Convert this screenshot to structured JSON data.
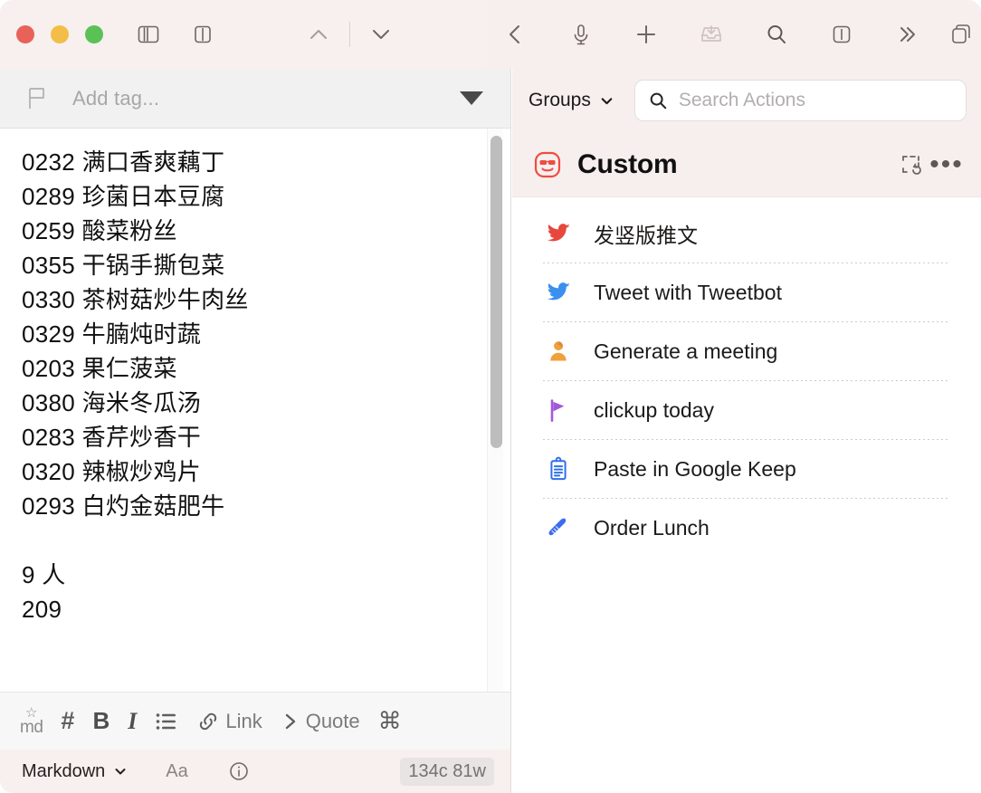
{
  "window": {
    "traffic_lights": [
      {
        "name": "close",
        "color": "#E8625A"
      },
      {
        "name": "minimize",
        "color": "#F2BE48"
      },
      {
        "name": "zoom",
        "color": "#5AC255"
      }
    ]
  },
  "toolbar": {
    "icons": [
      {
        "name": "sidebar-toggle-icon",
        "label": "Toggle Sidebar"
      },
      {
        "name": "editor-toggle-icon",
        "label": "Toggle Editor"
      },
      {
        "name": "chevron-up-icon",
        "label": "Previous"
      },
      {
        "name": "chevron-down-icon",
        "label": "Next"
      },
      {
        "name": "back-chevron-icon",
        "label": "Back"
      },
      {
        "name": "microphone-icon",
        "label": "Dictate"
      },
      {
        "name": "plus-icon",
        "label": "New Note"
      },
      {
        "name": "inbox-icon",
        "label": "Inbox"
      },
      {
        "name": "search-icon",
        "label": "Search"
      },
      {
        "name": "panel-toggle-icon",
        "label": "Toggle Panel"
      },
      {
        "name": "chevrons-right-icon",
        "label": "More"
      },
      {
        "name": "copy-icon",
        "label": "Duplicate"
      }
    ]
  },
  "editor": {
    "tag_bar": {
      "flag_icon": "flag-icon",
      "placeholder": "Add tag...",
      "caret_icon": "caret-down-icon"
    },
    "content": "0232 满口香爽藕丁\n0289 珍菌日本豆腐\n0259 酸菜粉丝\n0355 干锅手撕包菜\n0330 茶树菇炒牛肉丝\n0329 牛腩炖时蔬\n0203 果仁菠菜\n0380 海米冬瓜汤\n0283 香芹炒香干\n0320 辣椒炒鸡片\n0293 白灼金菇肥牛\n\n9 人\n209",
    "lines": [
      "0232 满口香爽藕丁",
      "0289 珍菌日本豆腐",
      "0259 酸菜粉丝",
      "0355 干锅手撕包菜",
      "0330 茶树菇炒牛肉丝",
      "0329 牛腩炖时蔬",
      "0203 果仁菠菜",
      "0380 海米冬瓜汤",
      "0283 香芹炒香干",
      "0320 辣椒炒鸡片",
      "0293 白灼金菇肥牛",
      "",
      "9 人",
      "209"
    ]
  },
  "format_bar": {
    "md_star": "☆",
    "md_text": "md",
    "heading": "#",
    "bold": "B",
    "italic": "I",
    "list_icon": "bullet-list-icon",
    "link_label": "Link",
    "quote_label": "Quote",
    "command": "⌘"
  },
  "status_bar": {
    "mode": "Markdown",
    "mode_caret": "chevron-down-icon",
    "font_size_label": "Aa",
    "info_icon": "info-icon",
    "counts": "134c 81w"
  },
  "actions_panel": {
    "groups_label": "Groups",
    "groups_caret": "chevron-down-icon",
    "search": {
      "icon": "search-icon",
      "placeholder": "Search Actions",
      "value": ""
    },
    "group": {
      "icon": "sunglasses-face-icon",
      "icon_color": "#EE4D42",
      "title": "Custom",
      "refresh_icon": "reload-frame-icon",
      "more_icon": "ellipsis-icon"
    },
    "items": [
      {
        "icon": "twitter-bird-icon",
        "color": "#E8473C",
        "label": "发竖版推文"
      },
      {
        "icon": "twitter-bird-icon",
        "color": "#3B8FEF",
        "label": "Tweet with Tweetbot"
      },
      {
        "icon": "person-silhouette-icon",
        "color": "#F0A03C",
        "label": "Generate a meeting"
      },
      {
        "icon": "flag-icon",
        "color": "#A259D9",
        "label": "clickup today"
      },
      {
        "icon": "clipboard-icon",
        "color": "#2F6FE8",
        "label": "Paste in Google Keep"
      },
      {
        "icon": "baguette-icon",
        "color": "#3C6CF0",
        "label": "Order Lunch"
      }
    ]
  }
}
